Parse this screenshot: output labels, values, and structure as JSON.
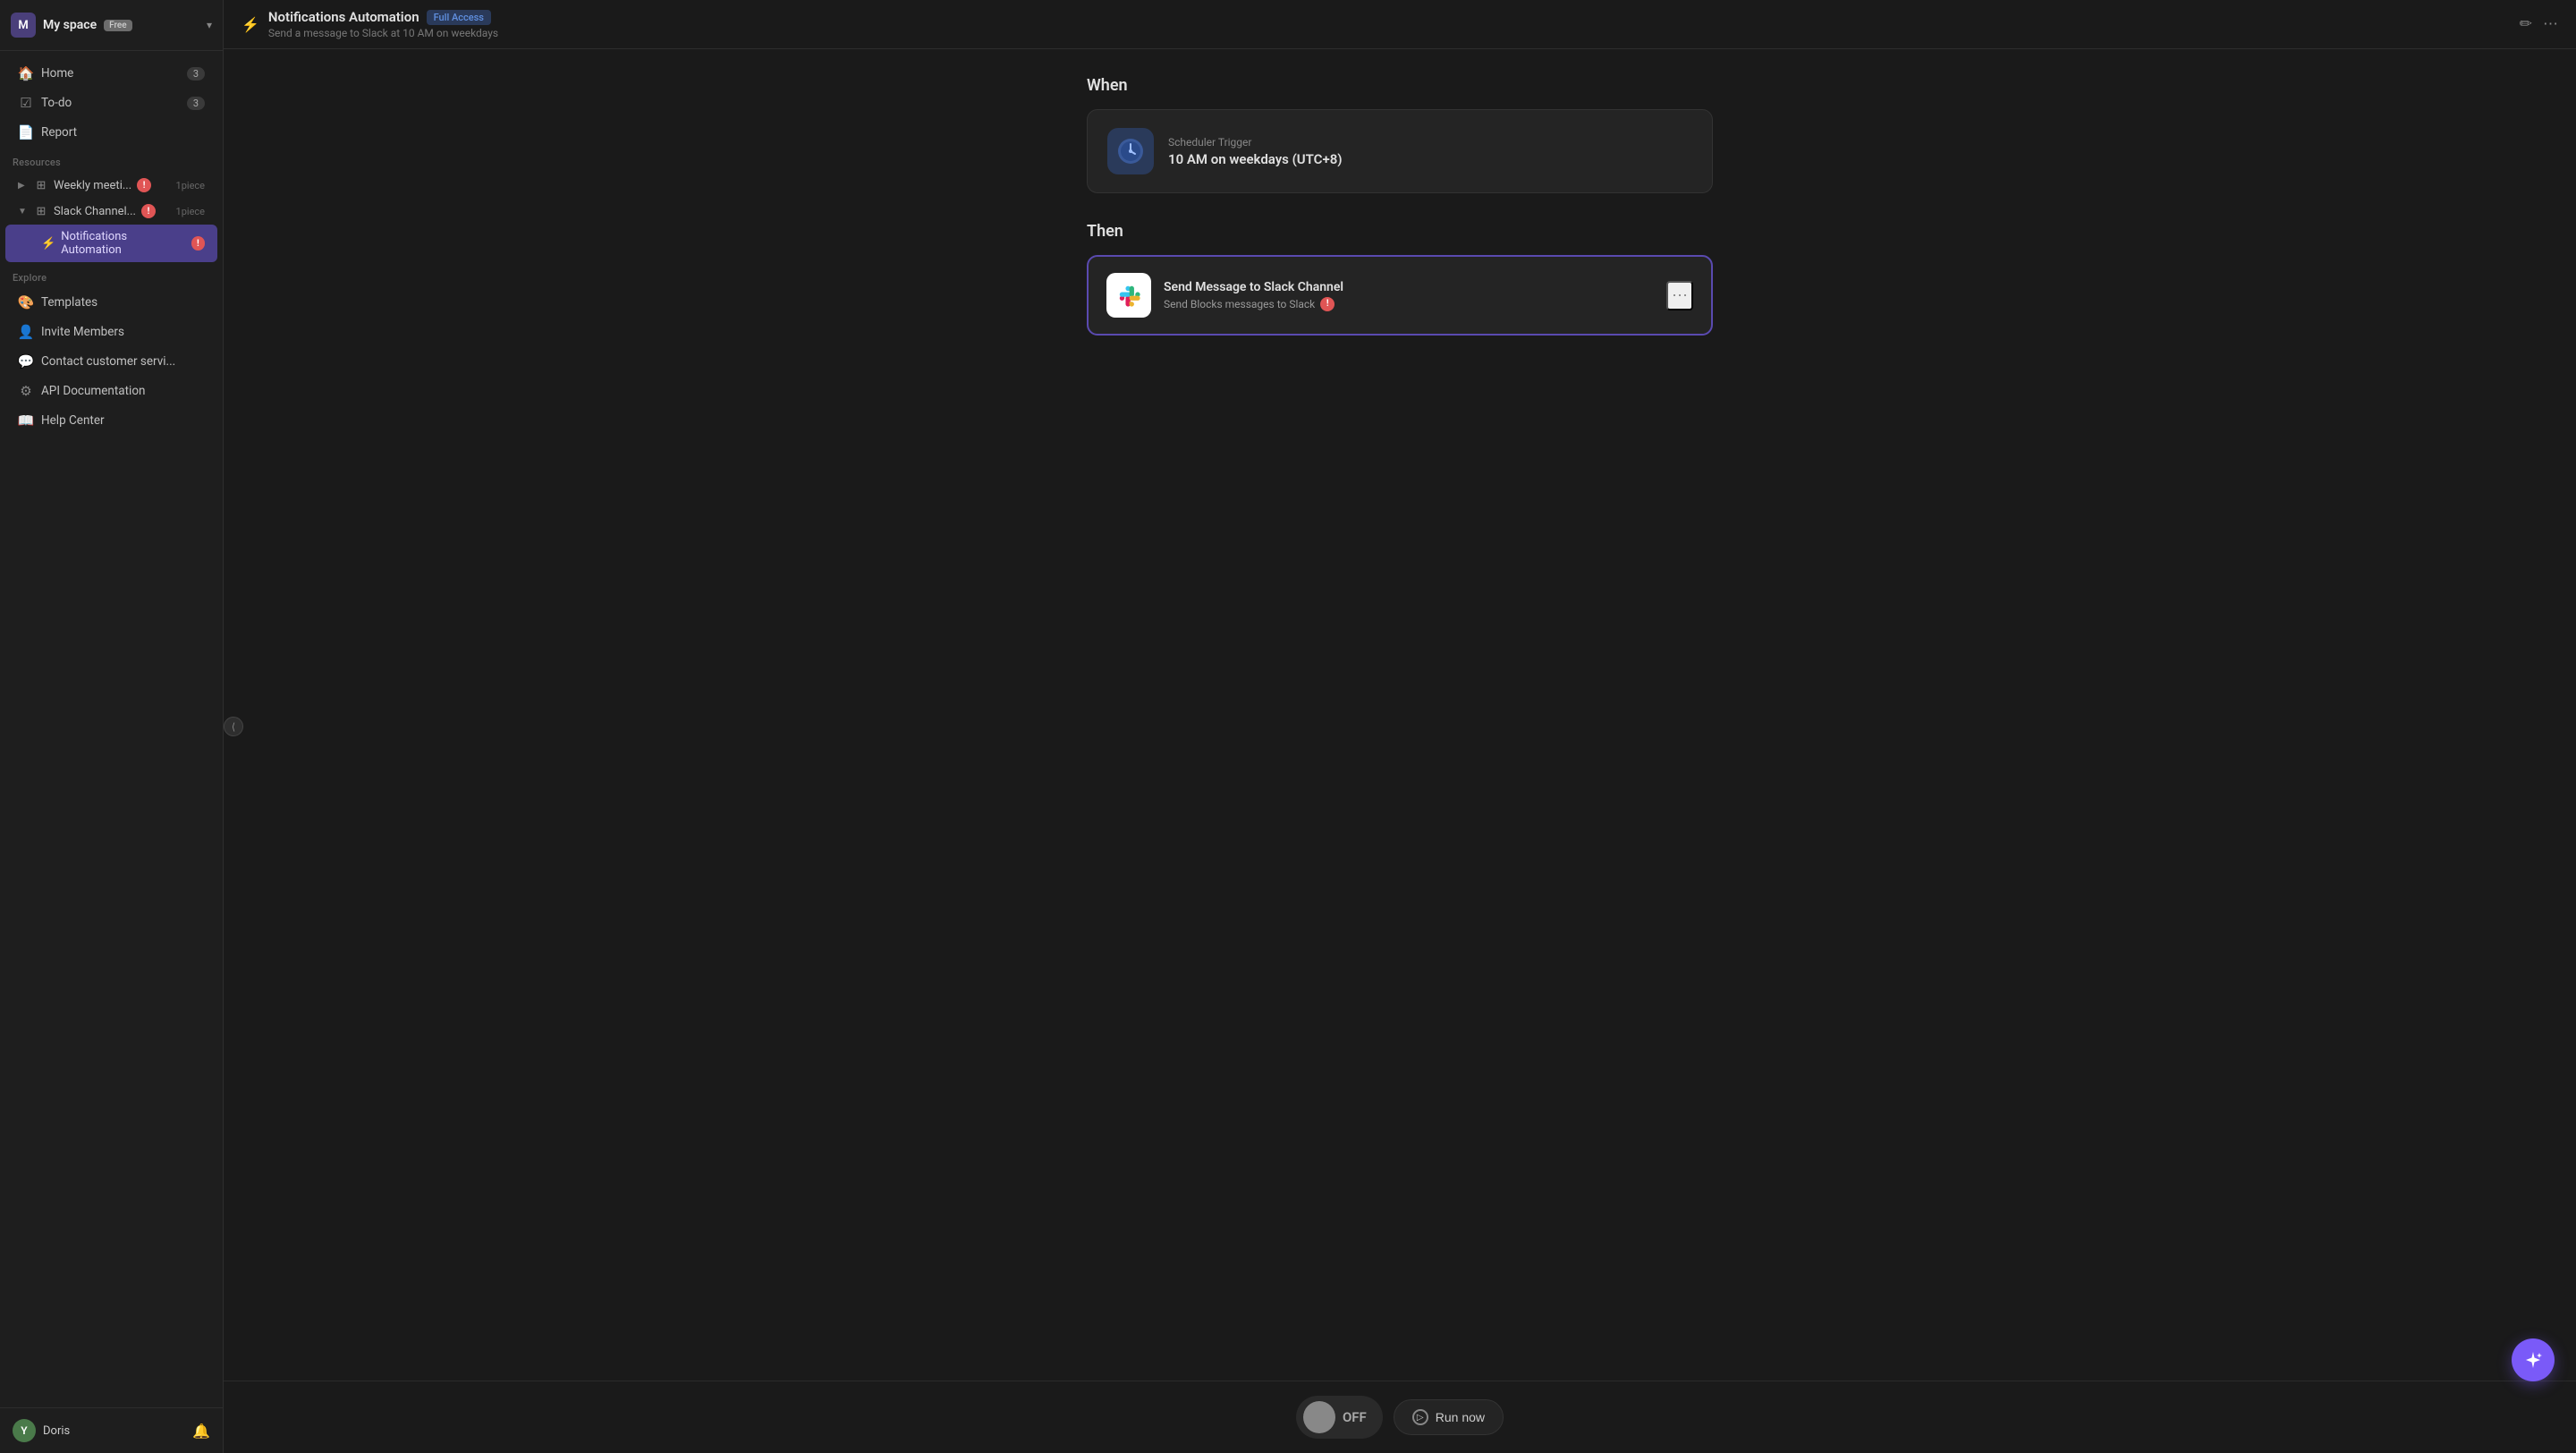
{
  "sidebar": {
    "space": {
      "avatar": "M",
      "name": "My space",
      "plan": "Free"
    },
    "nav": [
      {
        "id": "home",
        "icon": "🏠",
        "label": "Home",
        "badge": "3"
      },
      {
        "id": "todo",
        "icon": "☑",
        "label": "To-do",
        "badge": "3"
      },
      {
        "id": "report",
        "icon": "📄",
        "label": "Report",
        "badge": null
      }
    ],
    "resources_label": "Resources",
    "resources": [
      {
        "id": "weekly",
        "icon": "⊞",
        "label": "Weekly meeti...",
        "has_dot": true,
        "piece": "1piece",
        "expanded": false
      },
      {
        "id": "slack_channel",
        "icon": "⊞",
        "label": "Slack Channel...",
        "has_dot": true,
        "piece": "1piece",
        "expanded": true
      }
    ],
    "active_sub": "Notifications Automation",
    "active_sub_has_dot": true,
    "explore_label": "Explore",
    "explore": [
      {
        "id": "templates",
        "icon": "🎨",
        "label": "Templates"
      },
      {
        "id": "invite",
        "icon": "👤",
        "label": "Invite Members"
      },
      {
        "id": "contact",
        "icon": "💬",
        "label": "Contact customer servi..."
      },
      {
        "id": "api",
        "icon": "⚙",
        "label": "API Documentation"
      },
      {
        "id": "help",
        "icon": "📖",
        "label": "Help Center"
      }
    ],
    "user": {
      "avatar": "Y",
      "name": "Doris"
    }
  },
  "topbar": {
    "icon": "⚡",
    "title": "Notifications Automation",
    "badge": "Full Access",
    "subtitle": "Send a message to Slack at 10 AM on weekdays"
  },
  "flow": {
    "when_label": "When",
    "trigger": {
      "icon": "🕐",
      "label": "Scheduler Trigger",
      "value": "10 AM on weekdays (UTC+8)"
    },
    "then_label": "Then",
    "action": {
      "title": "Send Message to Slack Channel",
      "subtitle": "Send Blocks messages to Slack",
      "has_warning": true
    }
  },
  "bottom": {
    "toggle_state": "OFF",
    "run_label": "Run now"
  }
}
